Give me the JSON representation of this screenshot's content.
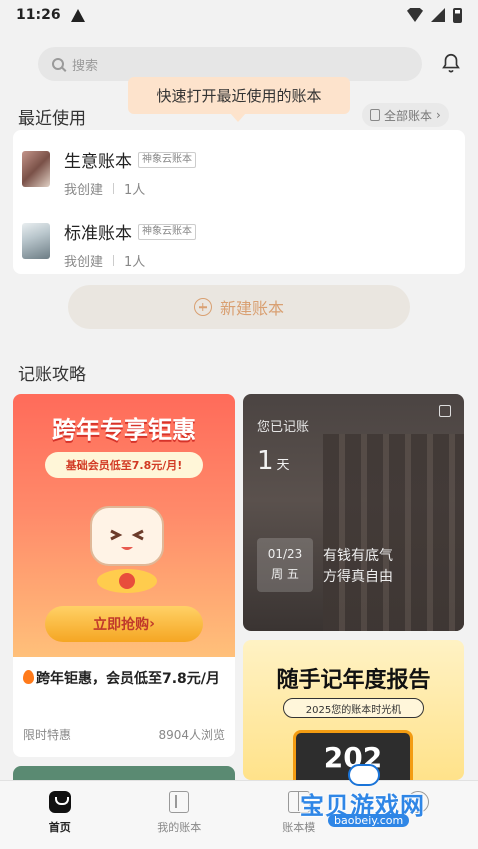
{
  "status_bar": {
    "time": "11:26"
  },
  "search": {
    "placeholder": "搜索"
  },
  "recent": {
    "title": "最近使用",
    "all_label": "全部账本",
    "tooltip": "快速打开最近使用的账本",
    "accounts": [
      {
        "name": "生意账本",
        "tag": "神象云账本",
        "creator": "我创建",
        "members": "1人"
      },
      {
        "name": "标准账本",
        "tag": "神象云账本",
        "creator": "我创建",
        "members": "1人"
      }
    ]
  },
  "new_account_label": "新建账本",
  "guide": {
    "title": "记账攻略",
    "promo": {
      "headline": "跨年专享钜惠",
      "ribbon": "基础会员低至7.8元/月!",
      "button": "立即抢购",
      "text": "跨年钜惠，会员低至7.8元/月",
      "tag": "限时特惠",
      "views": "8904人浏览"
    },
    "diary": {
      "label": "您已记账",
      "days": "1",
      "days_unit": "天",
      "date": "01/23",
      "weekday": "周 五",
      "quote_line1": "有钱有底气",
      "quote_line2": "方得真自由"
    },
    "report": {
      "title": "随手记年度报告",
      "subtitle": "2025您的账本时光机",
      "year": "202"
    }
  },
  "tabs": [
    {
      "label": "首页",
      "icon": "home-icon",
      "active": true
    },
    {
      "label": "我的账本",
      "icon": "book-icon",
      "active": false
    },
    {
      "label": "账本模",
      "icon": "template-icon",
      "active": false
    },
    {
      "label": "",
      "icon": "mine-icon",
      "active": false
    }
  ],
  "watermark": {
    "text": "宝贝游戏网",
    "url": "baobeiy.com"
  }
}
